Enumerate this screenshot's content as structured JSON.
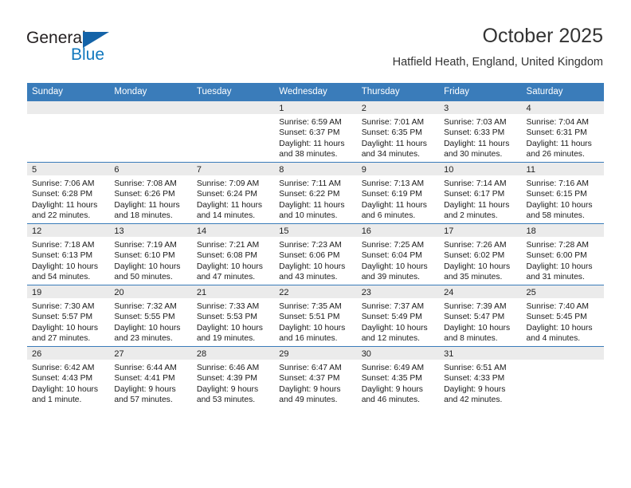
{
  "logo": {
    "word_top": "General",
    "word_bottom": "Blue",
    "accent_color": "#1463a8",
    "blue_text_color": "#1278be"
  },
  "header": {
    "title": "October 2025",
    "subtitle": "Hatfield Heath, England, United Kingdom",
    "header_bg_color": "#3a7cba",
    "daynum_band_color": "#ebebeb"
  },
  "weekday_headers": [
    "Sunday",
    "Monday",
    "Tuesday",
    "Wednesday",
    "Thursday",
    "Friday",
    "Saturday"
  ],
  "weeks": [
    [
      {
        "day": "",
        "empty": true
      },
      {
        "day": "",
        "empty": true
      },
      {
        "day": "",
        "empty": true
      },
      {
        "day": "1",
        "sunrise": "Sunrise: 6:59 AM",
        "sunset": "Sunset: 6:37 PM",
        "daylight": "Daylight: 11 hours and 38 minutes."
      },
      {
        "day": "2",
        "sunrise": "Sunrise: 7:01 AM",
        "sunset": "Sunset: 6:35 PM",
        "daylight": "Daylight: 11 hours and 34 minutes."
      },
      {
        "day": "3",
        "sunrise": "Sunrise: 7:03 AM",
        "sunset": "Sunset: 6:33 PM",
        "daylight": "Daylight: 11 hours and 30 minutes."
      },
      {
        "day": "4",
        "sunrise": "Sunrise: 7:04 AM",
        "sunset": "Sunset: 6:31 PM",
        "daylight": "Daylight: 11 hours and 26 minutes."
      }
    ],
    [
      {
        "day": "5",
        "sunrise": "Sunrise: 7:06 AM",
        "sunset": "Sunset: 6:28 PM",
        "daylight": "Daylight: 11 hours and 22 minutes."
      },
      {
        "day": "6",
        "sunrise": "Sunrise: 7:08 AM",
        "sunset": "Sunset: 6:26 PM",
        "daylight": "Daylight: 11 hours and 18 minutes."
      },
      {
        "day": "7",
        "sunrise": "Sunrise: 7:09 AM",
        "sunset": "Sunset: 6:24 PM",
        "daylight": "Daylight: 11 hours and 14 minutes."
      },
      {
        "day": "8",
        "sunrise": "Sunrise: 7:11 AM",
        "sunset": "Sunset: 6:22 PM",
        "daylight": "Daylight: 11 hours and 10 minutes."
      },
      {
        "day": "9",
        "sunrise": "Sunrise: 7:13 AM",
        "sunset": "Sunset: 6:19 PM",
        "daylight": "Daylight: 11 hours and 6 minutes."
      },
      {
        "day": "10",
        "sunrise": "Sunrise: 7:14 AM",
        "sunset": "Sunset: 6:17 PM",
        "daylight": "Daylight: 11 hours and 2 minutes."
      },
      {
        "day": "11",
        "sunrise": "Sunrise: 7:16 AM",
        "sunset": "Sunset: 6:15 PM",
        "daylight": "Daylight: 10 hours and 58 minutes."
      }
    ],
    [
      {
        "day": "12",
        "sunrise": "Sunrise: 7:18 AM",
        "sunset": "Sunset: 6:13 PM",
        "daylight": "Daylight: 10 hours and 54 minutes."
      },
      {
        "day": "13",
        "sunrise": "Sunrise: 7:19 AM",
        "sunset": "Sunset: 6:10 PM",
        "daylight": "Daylight: 10 hours and 50 minutes."
      },
      {
        "day": "14",
        "sunrise": "Sunrise: 7:21 AM",
        "sunset": "Sunset: 6:08 PM",
        "daylight": "Daylight: 10 hours and 47 minutes."
      },
      {
        "day": "15",
        "sunrise": "Sunrise: 7:23 AM",
        "sunset": "Sunset: 6:06 PM",
        "daylight": "Daylight: 10 hours and 43 minutes."
      },
      {
        "day": "16",
        "sunrise": "Sunrise: 7:25 AM",
        "sunset": "Sunset: 6:04 PM",
        "daylight": "Daylight: 10 hours and 39 minutes."
      },
      {
        "day": "17",
        "sunrise": "Sunrise: 7:26 AM",
        "sunset": "Sunset: 6:02 PM",
        "daylight": "Daylight: 10 hours and 35 minutes."
      },
      {
        "day": "18",
        "sunrise": "Sunrise: 7:28 AM",
        "sunset": "Sunset: 6:00 PM",
        "daylight": "Daylight: 10 hours and 31 minutes."
      }
    ],
    [
      {
        "day": "19",
        "sunrise": "Sunrise: 7:30 AM",
        "sunset": "Sunset: 5:57 PM",
        "daylight": "Daylight: 10 hours and 27 minutes."
      },
      {
        "day": "20",
        "sunrise": "Sunrise: 7:32 AM",
        "sunset": "Sunset: 5:55 PM",
        "daylight": "Daylight: 10 hours and 23 minutes."
      },
      {
        "day": "21",
        "sunrise": "Sunrise: 7:33 AM",
        "sunset": "Sunset: 5:53 PM",
        "daylight": "Daylight: 10 hours and 19 minutes."
      },
      {
        "day": "22",
        "sunrise": "Sunrise: 7:35 AM",
        "sunset": "Sunset: 5:51 PM",
        "daylight": "Daylight: 10 hours and 16 minutes."
      },
      {
        "day": "23",
        "sunrise": "Sunrise: 7:37 AM",
        "sunset": "Sunset: 5:49 PM",
        "daylight": "Daylight: 10 hours and 12 minutes."
      },
      {
        "day": "24",
        "sunrise": "Sunrise: 7:39 AM",
        "sunset": "Sunset: 5:47 PM",
        "daylight": "Daylight: 10 hours and 8 minutes."
      },
      {
        "day": "25",
        "sunrise": "Sunrise: 7:40 AM",
        "sunset": "Sunset: 5:45 PM",
        "daylight": "Daylight: 10 hours and 4 minutes."
      }
    ],
    [
      {
        "day": "26",
        "sunrise": "Sunrise: 6:42 AM",
        "sunset": "Sunset: 4:43 PM",
        "daylight": "Daylight: 10 hours and 1 minute."
      },
      {
        "day": "27",
        "sunrise": "Sunrise: 6:44 AM",
        "sunset": "Sunset: 4:41 PM",
        "daylight": "Daylight: 9 hours and 57 minutes."
      },
      {
        "day": "28",
        "sunrise": "Sunrise: 6:46 AM",
        "sunset": "Sunset: 4:39 PM",
        "daylight": "Daylight: 9 hours and 53 minutes."
      },
      {
        "day": "29",
        "sunrise": "Sunrise: 6:47 AM",
        "sunset": "Sunset: 4:37 PM",
        "daylight": "Daylight: 9 hours and 49 minutes."
      },
      {
        "day": "30",
        "sunrise": "Sunrise: 6:49 AM",
        "sunset": "Sunset: 4:35 PM",
        "daylight": "Daylight: 9 hours and 46 minutes."
      },
      {
        "day": "31",
        "sunrise": "Sunrise: 6:51 AM",
        "sunset": "Sunset: 4:33 PM",
        "daylight": "Daylight: 9 hours and 42 minutes."
      },
      {
        "day": "",
        "empty": true
      }
    ]
  ]
}
